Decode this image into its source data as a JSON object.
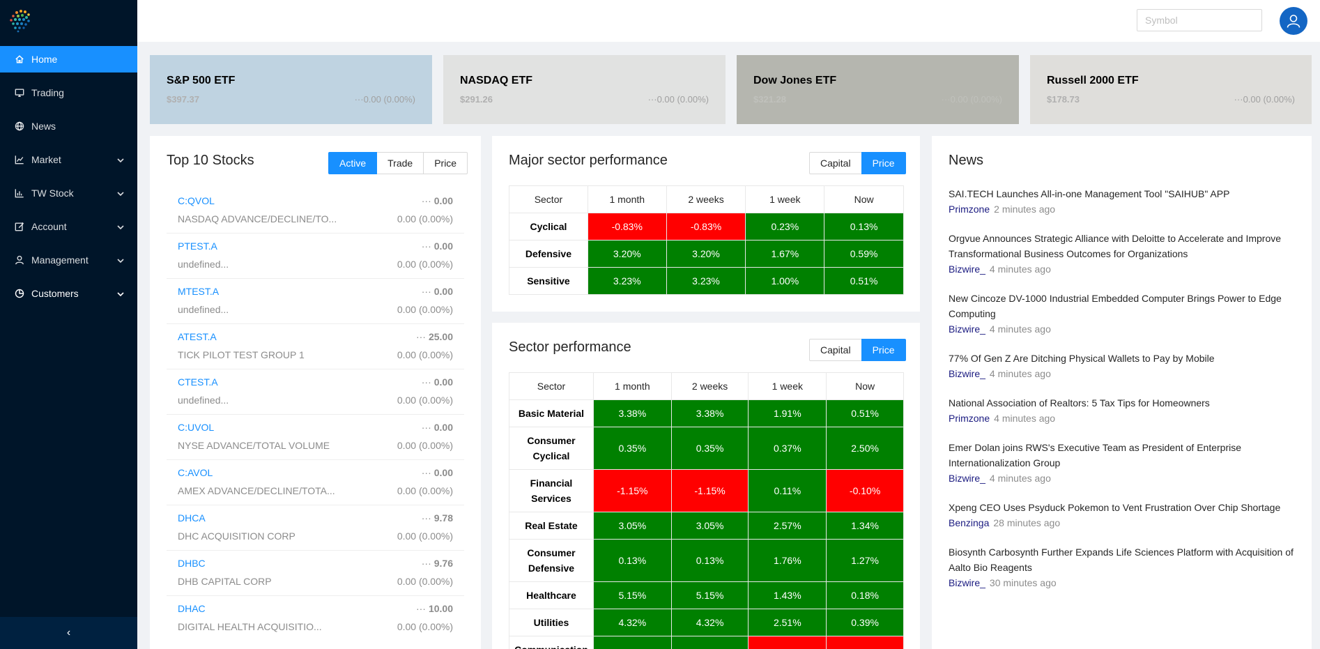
{
  "header": {
    "symbol_placeholder": "Symbol"
  },
  "sidebar": {
    "items": [
      {
        "label": "Home",
        "icon": "home-icon"
      },
      {
        "label": "Trading",
        "icon": "desktop-icon"
      },
      {
        "label": "News",
        "icon": "globe-icon"
      },
      {
        "label": "Market",
        "icon": "line-chart-icon"
      },
      {
        "label": "TW Stock",
        "icon": "bar-chart-icon"
      },
      {
        "label": "Account",
        "icon": "edit-icon"
      },
      {
        "label": "Management",
        "icon": "user-icon"
      },
      {
        "label": "Customers",
        "icon": "pie-chart-icon"
      }
    ],
    "collapse_glyph": "‹"
  },
  "etfs": [
    {
      "name": "S&P 500 ETF",
      "price": "$397.37",
      "change": "0.00 (0.00%)",
      "bg": "#bfd3e1"
    },
    {
      "name": "NASDAQ ETF",
      "price": "$291.26",
      "change": "0.00 (0.00%)",
      "bg": "#e1e2e1"
    },
    {
      "name": "Dow Jones ETF",
      "price": "$321.28",
      "change": "0.00 (0.00%)",
      "bg": "#b5b6af"
    },
    {
      "name": "Russell 2000 ETF",
      "price": "$178.73",
      "change": "0.00 (0.00%)",
      "bg": "#dfdedb"
    }
  ],
  "top_stocks": {
    "title": "Top 10 Stocks",
    "tabs": [
      "Active",
      "Trade",
      "Price"
    ],
    "items": [
      {
        "symbol": "C:QVOL",
        "desc": "NASDAQ ADVANCE/DECLINE/TO...",
        "value": "0.00",
        "change": "0.00 (0.00%)"
      },
      {
        "symbol": "PTEST.A",
        "desc": "undefined...",
        "value": "0.00",
        "change": "0.00 (0.00%)"
      },
      {
        "symbol": "MTEST.A",
        "desc": "undefined...",
        "value": "0.00",
        "change": "0.00 (0.00%)"
      },
      {
        "symbol": "ATEST.A",
        "desc": "TICK PILOT TEST GROUP 1",
        "value": "25.00",
        "change": "0.00 (0.00%)"
      },
      {
        "symbol": "CTEST.A",
        "desc": "undefined...",
        "value": "0.00",
        "change": "0.00 (0.00%)"
      },
      {
        "symbol": "C:UVOL",
        "desc": "NYSE ADVANCE/TOTAL VOLUME",
        "value": "0.00",
        "change": "0.00 (0.00%)"
      },
      {
        "symbol": "C:AVOL",
        "desc": "AMEX ADVANCE/DECLINE/TOTA...",
        "value": "0.00",
        "change": "0.00 (0.00%)"
      },
      {
        "symbol": "DHCA",
        "desc": "DHC ACQUISITION CORP",
        "value": "9.78",
        "change": "0.00 (0.00%)"
      },
      {
        "symbol": "DHBC",
        "desc": "DHB CAPITAL CORP",
        "value": "9.76",
        "change": "0.00 (0.00%)"
      },
      {
        "symbol": "DHAC",
        "desc": "DIGITAL HEALTH ACQUISITIO...",
        "value": "10.00",
        "change": "0.00 (0.00%)"
      }
    ]
  },
  "major_sector": {
    "title": "Major sector performance",
    "toggle": [
      "Capital",
      "Price"
    ],
    "columns": [
      "Sector",
      "1 month",
      "2 weeks",
      "1 week",
      "Now"
    ],
    "rows": [
      {
        "sector": "Cyclical",
        "values": [
          "-0.83%",
          "-0.83%",
          "0.23%",
          "0.13%"
        ]
      },
      {
        "sector": "Defensive",
        "values": [
          "3.20%",
          "3.20%",
          "1.67%",
          "0.59%"
        ]
      },
      {
        "sector": "Sensitive",
        "values": [
          "3.23%",
          "3.23%",
          "1.00%",
          "0.51%"
        ]
      }
    ]
  },
  "sector_perf": {
    "title": "Sector performance",
    "toggle": [
      "Capital",
      "Price"
    ],
    "columns": [
      "Sector",
      "1 month",
      "2 weeks",
      "1 week",
      "Now"
    ],
    "rows": [
      {
        "sector": "Basic Material",
        "values": [
          "3.38%",
          "3.38%",
          "1.91%",
          "0.51%"
        ]
      },
      {
        "sector": "Consumer Cyclical",
        "values": [
          "0.35%",
          "0.35%",
          "0.37%",
          "2.50%"
        ]
      },
      {
        "sector": "Financial Services",
        "values": [
          "-1.15%",
          "-1.15%",
          "0.11%",
          "-0.10%"
        ]
      },
      {
        "sector": "Real Estate",
        "values": [
          "3.05%",
          "3.05%",
          "2.57%",
          "1.34%"
        ]
      },
      {
        "sector": "Consumer Defensive",
        "values": [
          "0.13%",
          "0.13%",
          "1.76%",
          "1.27%"
        ]
      },
      {
        "sector": "Healthcare",
        "values": [
          "5.15%",
          "5.15%",
          "1.43%",
          "0.18%"
        ]
      },
      {
        "sector": "Utilities",
        "values": [
          "4.32%",
          "4.32%",
          "2.51%",
          "0.39%"
        ]
      },
      {
        "sector": "Communication",
        "values": [
          "",
          "",
          "",
          ""
        ],
        "colors": [
          "pos",
          "pos",
          "neg",
          "neg"
        ]
      }
    ]
  },
  "news": {
    "title": "News",
    "items": [
      {
        "headline": "SAI.TECH Launches All-in-one Management Tool \"SAIHUB\" APP",
        "source": "Primzone",
        "time": "2 minutes ago"
      },
      {
        "headline": "Orgvue Announces Strategic Alliance with Deloitte to Accelerate and Improve Transformational Business Outcomes for Organizations",
        "source": "Bizwire_",
        "time": "4 minutes ago"
      },
      {
        "headline": "New Cincoze DV-1000 Industrial Embedded Computer Brings Power to Edge Computing",
        "source": "Bizwire_",
        "time": "4 minutes ago"
      },
      {
        "headline": "77% Of Gen Z Are Ditching Physical Wallets to Pay by Mobile",
        "source": "Bizwire_",
        "time": "4 minutes ago"
      },
      {
        "headline": "National Association of Realtors: 5 Tax Tips for Homeowners",
        "source": "Primzone",
        "time": "4 minutes ago"
      },
      {
        "headline": "Emer Dolan joins RWS's Executive Team as President of Enterprise Internationalization Group",
        "source": "Bizwire_",
        "time": "4 minutes ago"
      },
      {
        "headline": "Xpeng CEO Uses Psyduck Pokemon to Vent Frustration Over Chip Shortage",
        "source": "Benzinga",
        "time": "28 minutes ago"
      },
      {
        "headline": "Biosynth Carbosynth Further Expands Life Sciences Platform with Acquisition of Aalto Bio Reagents",
        "source": "Bizwire_",
        "time": "30 minutes ago"
      }
    ]
  },
  "colors": {
    "sidebar_bg": "#001529",
    "accent": "#1890ff",
    "positive": "#008000",
    "negative": "#ff0000"
  }
}
